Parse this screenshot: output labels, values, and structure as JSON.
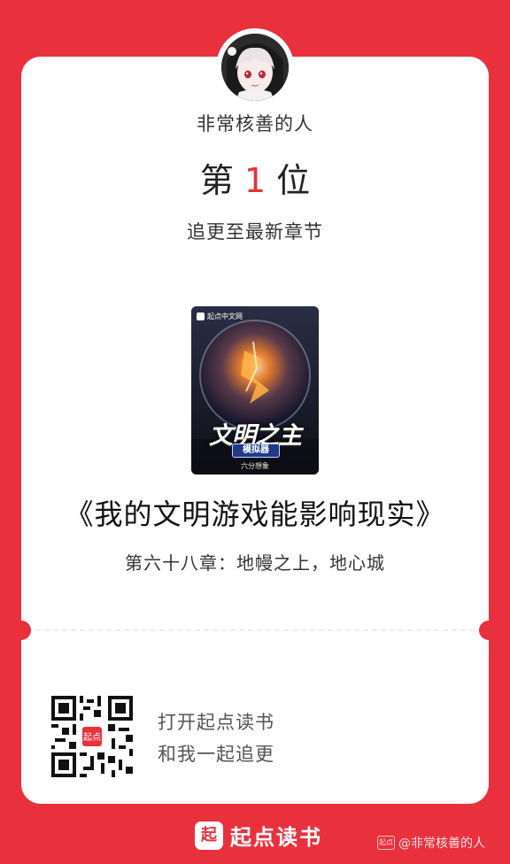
{
  "user": {
    "name": "非常核善的人"
  },
  "rank": {
    "prefix": "第",
    "number": "1",
    "suffix": "位",
    "description": "追更至最新章节"
  },
  "book": {
    "title": "《我的文明游戏能影响现实》",
    "chapter": "第六十八章：地幔之上，地心城",
    "cover": {
      "publisher": "起点中文网",
      "title": "文明之主",
      "subtitle": "模拟器",
      "author": "六分想象"
    }
  },
  "cta": {
    "line1": "打开起点读书",
    "line2": "和我一起追更",
    "qr_badge": "起点"
  },
  "footer": {
    "logo_mark": "起",
    "brand": "起点读书",
    "watermark_icon": "起点",
    "watermark": "@非常核善的人"
  },
  "colors": {
    "brand_red": "#E8313D",
    "card": "#FFFFFF"
  }
}
